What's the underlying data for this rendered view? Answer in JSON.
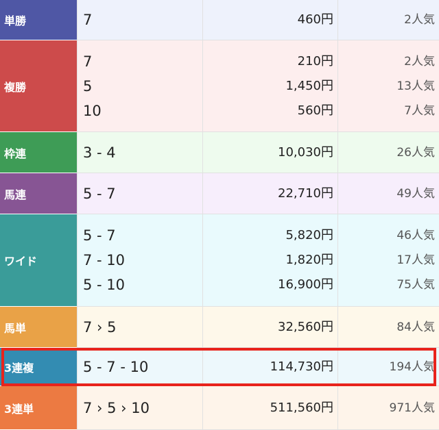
{
  "rows": [
    {
      "label": "単勝",
      "color": "#4f57a5",
      "bg": "#eef2fc",
      "nums": [
        "7"
      ],
      "payouts": [
        "460円"
      ],
      "pops": [
        "2人気"
      ]
    },
    {
      "label": "複勝",
      "color": "#cd4b4b",
      "bg": "#fdeeee",
      "nums": [
        "7",
        "5",
        "10"
      ],
      "payouts": [
        "210円",
        "1,450円",
        "560円"
      ],
      "pops": [
        "2人気",
        "13人気",
        "7人気"
      ]
    },
    {
      "label": "枠連",
      "color": "#3e9c56",
      "bg": "#eefbee",
      "nums": [
        "3 - 4"
      ],
      "payouts": [
        "10,030円"
      ],
      "pops": [
        "26人気"
      ]
    },
    {
      "label": "馬連",
      "color": "#875594",
      "bg": "#f7eefc",
      "nums": [
        "5 - 7"
      ],
      "payouts": [
        "22,710円"
      ],
      "pops": [
        "49人気"
      ]
    },
    {
      "label": "ワイド",
      "color": "#3a9c99",
      "bg": "#e9fafd",
      "nums": [
        "5 - 7",
        "7 - 10",
        "5 - 10"
      ],
      "payouts": [
        "5,820円",
        "1,820円",
        "16,900円"
      ],
      "pops": [
        "46人気",
        "17人気",
        "75人気"
      ]
    },
    {
      "label": "馬単",
      "color": "#e9a247",
      "bg": "#fef8ea",
      "nums": [
        "7 › 5"
      ],
      "payouts": [
        "32,560円"
      ],
      "pops": [
        "84人気"
      ]
    },
    {
      "label": "3連複",
      "color": "#338cb2",
      "bg": "#edf8fc",
      "nums": [
        "5 - 7 - 10"
      ],
      "payouts": [
        "114,730円"
      ],
      "pops": [
        "194人気"
      ]
    },
    {
      "label": "3連単",
      "color": "#ec7a42",
      "bg": "#fef4ea",
      "nums": [
        "7 › 5 › 10"
      ],
      "payouts": [
        "511,560円"
      ],
      "pops": [
        "971人気"
      ]
    }
  ],
  "highlight_color": "#e8231c"
}
